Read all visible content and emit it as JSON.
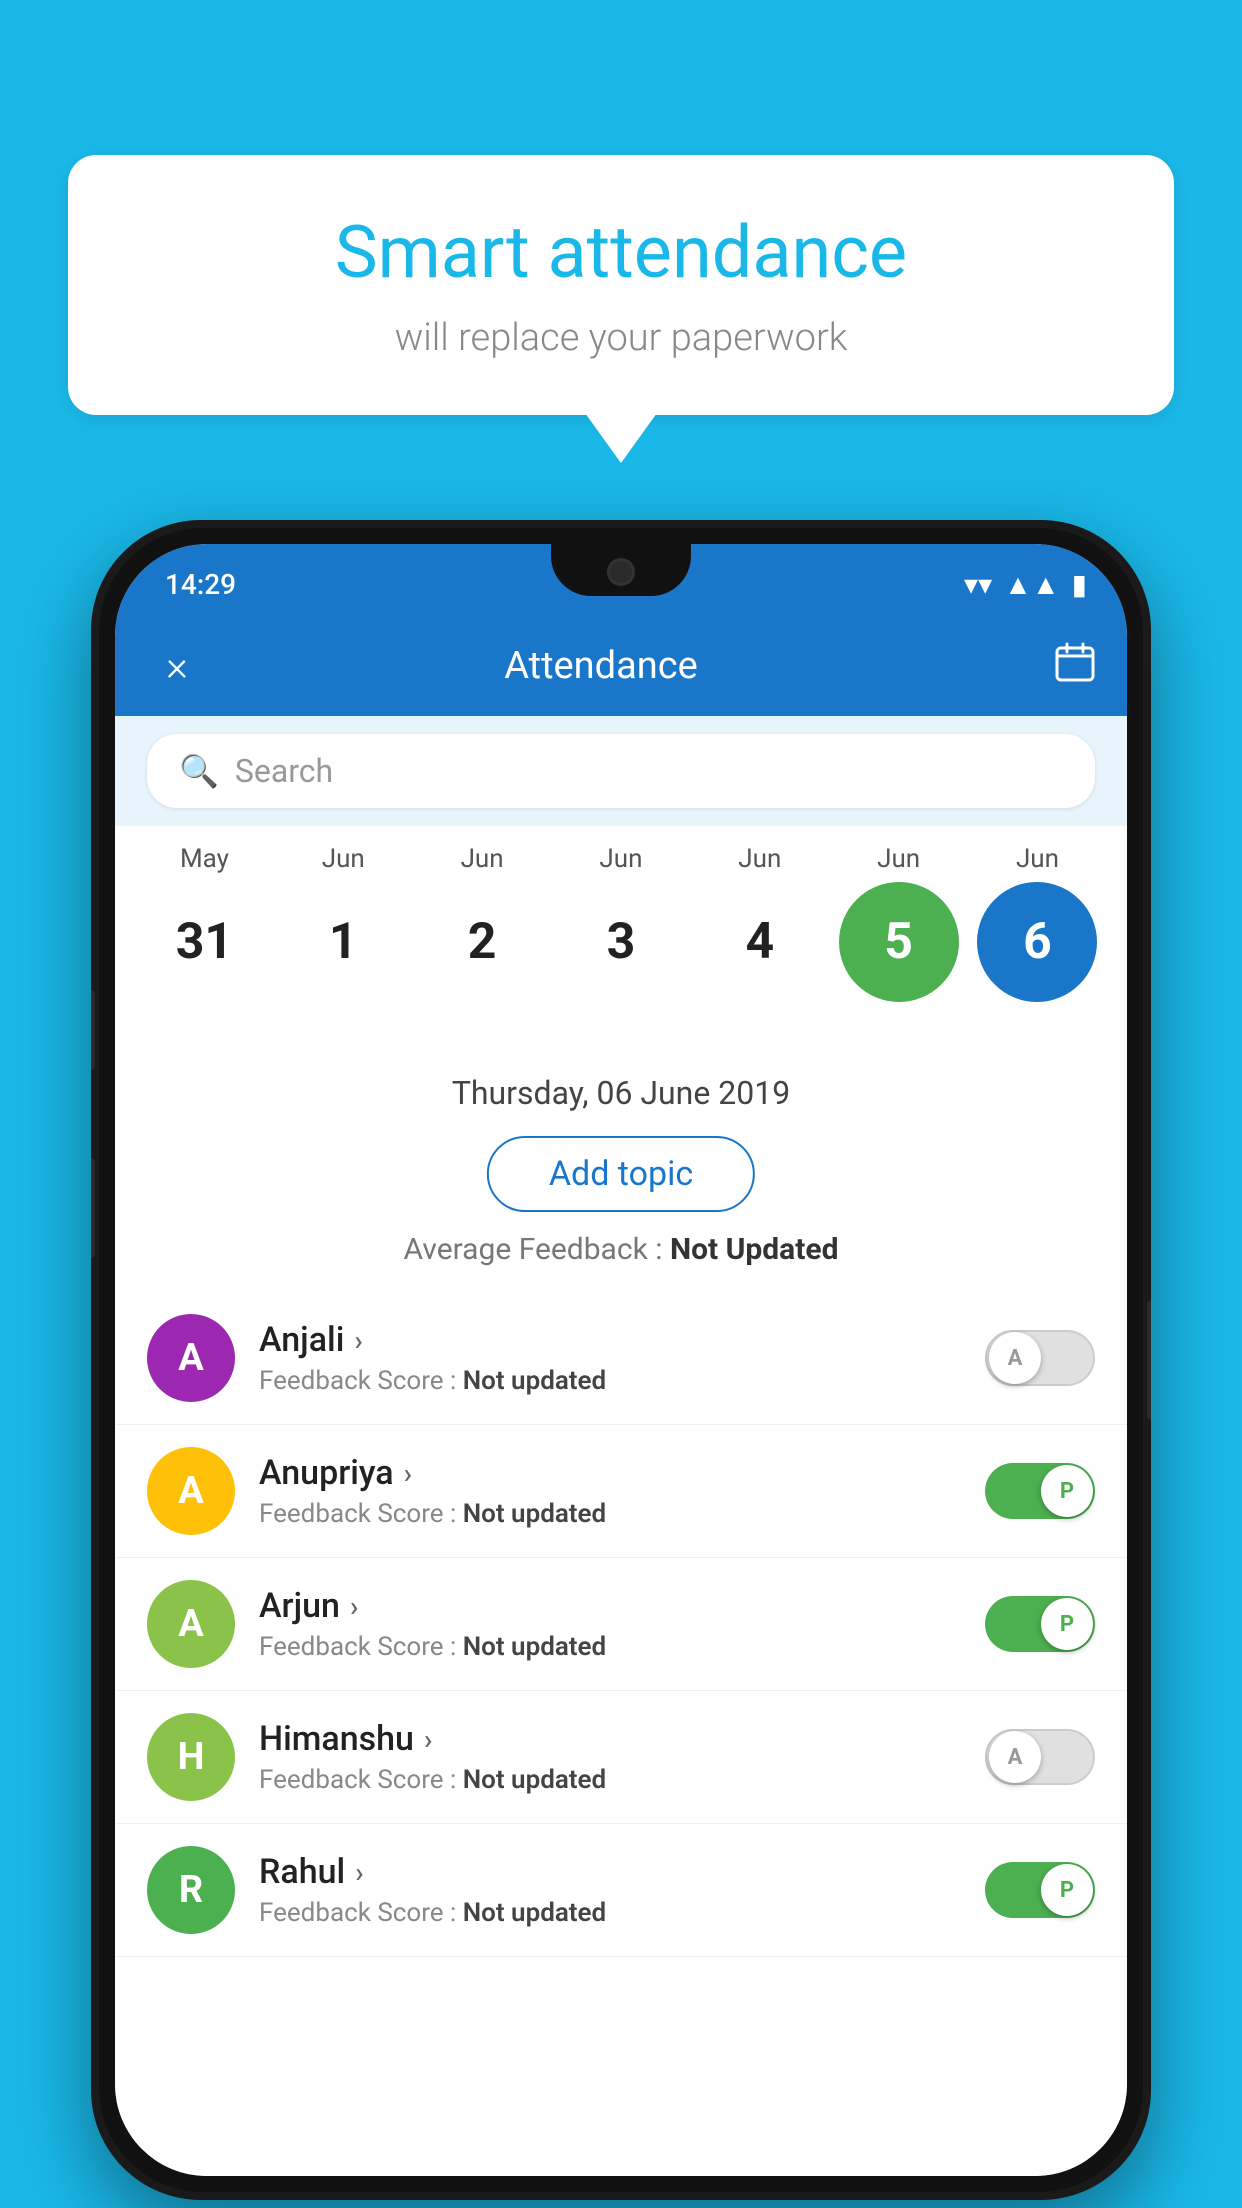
{
  "background_color": "#1ab8e8",
  "bubble": {
    "title": "Smart attendance",
    "subtitle": "will replace your paperwork"
  },
  "status_bar": {
    "time": "14:29",
    "icons": [
      "wifi",
      "signal",
      "battery"
    ]
  },
  "app_bar": {
    "title": "Attendance",
    "close_label": "×",
    "calendar_icon": "📅"
  },
  "search": {
    "placeholder": "Search"
  },
  "calendar": {
    "months": [
      "May",
      "Jun",
      "Jun",
      "Jun",
      "Jun",
      "Jun",
      "Jun"
    ],
    "dates": [
      "31",
      "1",
      "2",
      "3",
      "4",
      "5",
      "6"
    ],
    "today_index": 5,
    "selected_index": 6
  },
  "selected_date": "Thursday, 06 June 2019",
  "add_topic_label": "Add topic",
  "average_feedback": {
    "label": "Average Feedback : ",
    "value": "Not Updated"
  },
  "students": [
    {
      "name": "Anjali",
      "avatar_letter": "A",
      "avatar_color": "#9c27b0",
      "feedback_label": "Feedback Score : ",
      "feedback_value": "Not updated",
      "toggle_state": "off",
      "toggle_label": "A"
    },
    {
      "name": "Anupriya",
      "avatar_letter": "A",
      "avatar_color": "#ffc107",
      "feedback_label": "Feedback Score : ",
      "feedback_value": "Not updated",
      "toggle_state": "on",
      "toggle_label": "P"
    },
    {
      "name": "Arjun",
      "avatar_letter": "A",
      "avatar_color": "#8bc34a",
      "feedback_label": "Feedback Score : ",
      "feedback_value": "Not updated",
      "toggle_state": "on",
      "toggle_label": "P"
    },
    {
      "name": "Himanshu",
      "avatar_letter": "H",
      "avatar_color": "#8bc34a",
      "feedback_label": "Feedback Score : ",
      "feedback_value": "Not updated",
      "toggle_state": "off",
      "toggle_label": "A"
    },
    {
      "name": "Rahul",
      "avatar_letter": "R",
      "avatar_color": "#4caf50",
      "feedback_label": "Feedback Score : ",
      "feedback_value": "Not updated",
      "toggle_state": "on",
      "toggle_label": "P"
    }
  ]
}
